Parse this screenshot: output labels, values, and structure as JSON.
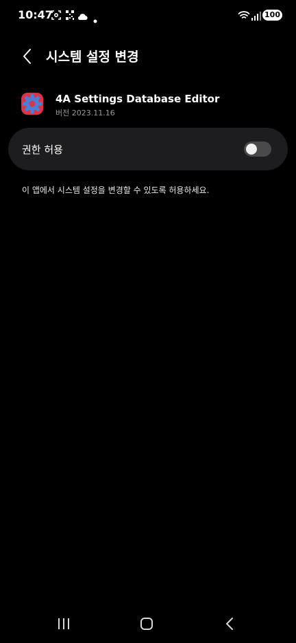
{
  "status_bar": {
    "time": "10:47",
    "battery": "100",
    "icons": [
      "screenshot-icon",
      "qr-icon",
      "cloud-icon",
      "notification-dot-icon",
      "wifi-icon",
      "signal-icon"
    ]
  },
  "header": {
    "title": "시스템 설정 변경",
    "back_icon": "chevron-left-icon"
  },
  "app": {
    "name": "4A Settings Database Editor",
    "version": "버전 2023.11.16",
    "icon": "app-gear-icon"
  },
  "permission": {
    "label": "권한 허용",
    "enabled": false
  },
  "description": "이 앱에서 시스템 설정을 변경할 수 있도록 허용하세요.",
  "nav_bar": {
    "icons": [
      "recents-icon",
      "home-icon",
      "back-icon"
    ]
  },
  "colors": {
    "background": "#000000",
    "card": "#1d1d1f",
    "toggle_off": "#4a4a4c",
    "app_icon_blue": "#4a7fd9",
    "app_icon_red": "#d9344a"
  }
}
